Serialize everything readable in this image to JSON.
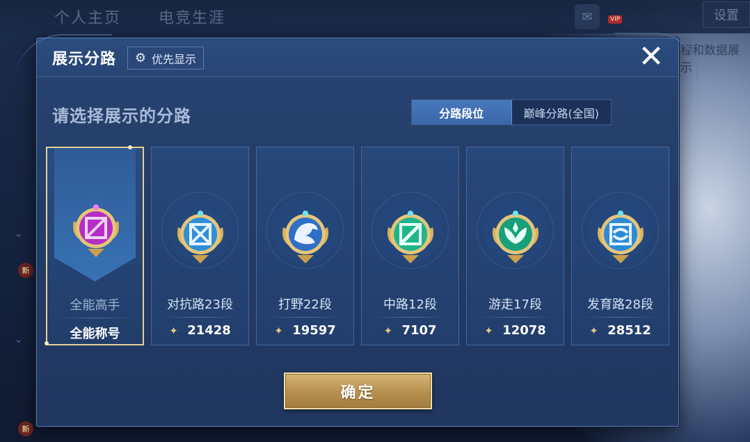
{
  "background": {
    "tabs": [
      "个人主页",
      "电竞生涯"
    ],
    "setting_label": "设置",
    "right_panel_text": "程和数据展示",
    "side_badge": "新"
  },
  "dialog": {
    "title": "展示分路",
    "priority_button": "优先显示",
    "close_icon": "close-icon",
    "subtitle": "请选择展示的分路",
    "segments": [
      {
        "label": "分路段位",
        "active": true
      },
      {
        "label": "巅峰分路(全国)",
        "active": false
      }
    ],
    "cards": [
      {
        "name": "全能高手",
        "bottom": "全能称号",
        "selected": true,
        "emblem_color": "#c43ccf",
        "icon": "all-round-emblem-icon"
      },
      {
        "name": "对抗路23段",
        "score": "21428",
        "selected": false,
        "emblem_color": "#2f8fd8",
        "icon": "clash-lane-emblem-icon"
      },
      {
        "name": "打野22段",
        "score": "19597",
        "selected": false,
        "emblem_color": "#2f6fc8",
        "icon": "jungle-emblem-icon"
      },
      {
        "name": "中路12段",
        "score": "7107",
        "selected": false,
        "emblem_color": "#1fb58a",
        "icon": "mid-lane-emblem-icon"
      },
      {
        "name": "游走17段",
        "score": "12078",
        "selected": false,
        "emblem_color": "#17a07a",
        "icon": "roam-emblem-icon"
      },
      {
        "name": "发育路28段",
        "score": "28512",
        "selected": false,
        "emblem_color": "#2c8ad8",
        "icon": "farm-lane-emblem-icon"
      }
    ],
    "confirm_label": "确定",
    "accent_gold": "#e7cf9a"
  }
}
